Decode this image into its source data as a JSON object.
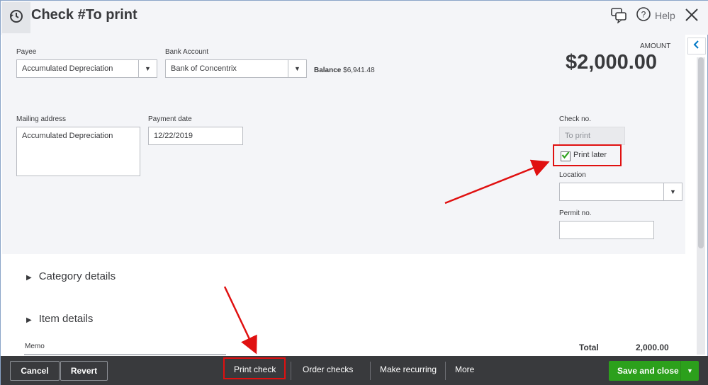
{
  "header": {
    "title": "Check #To print",
    "help_label": "Help"
  },
  "form": {
    "payee_label": "Payee",
    "payee_value": "Accumulated Depreciation",
    "bank_account_label": "Bank Account",
    "bank_account_value": "Bank of Concentrix",
    "balance_label": "Balance",
    "balance_value": "$6,941.48",
    "amount_label": "AMOUNT",
    "amount_value": "$2,000.00",
    "mailing_address_label": "Mailing address",
    "mailing_address_value": "Accumulated Depreciation",
    "payment_date_label": "Payment date",
    "payment_date_value": "12/22/2019",
    "check_no_label": "Check no.",
    "check_no_value": "To print",
    "print_later_label": "Print later",
    "print_later_checked": true,
    "location_label": "Location",
    "location_value": "",
    "permit_no_label": "Permit no.",
    "permit_no_value": ""
  },
  "sections": {
    "category_details": "Category details",
    "item_details": "Item details",
    "memo_label": "Memo",
    "total_label": "Total",
    "total_value": "2,000.00"
  },
  "footer": {
    "cancel": "Cancel",
    "revert": "Revert",
    "print_check": "Print check",
    "order_checks": "Order checks",
    "make_recurring": "Make recurring",
    "more": "More",
    "save_and_close": "Save and close"
  },
  "colors": {
    "panel_bg": "#f4f5f8",
    "footer_bg": "#393a3d",
    "save_green": "#2ca01c",
    "annotation_red": "#e01010"
  },
  "icons": {
    "history": "history-icon",
    "feedback": "feedback-icon",
    "help": "help-icon",
    "close": "close-icon",
    "collapse": "chevron-left-icon",
    "dropdown": "caret-down-icon",
    "expand": "caret-right-icon",
    "check": "checkmark-icon"
  }
}
